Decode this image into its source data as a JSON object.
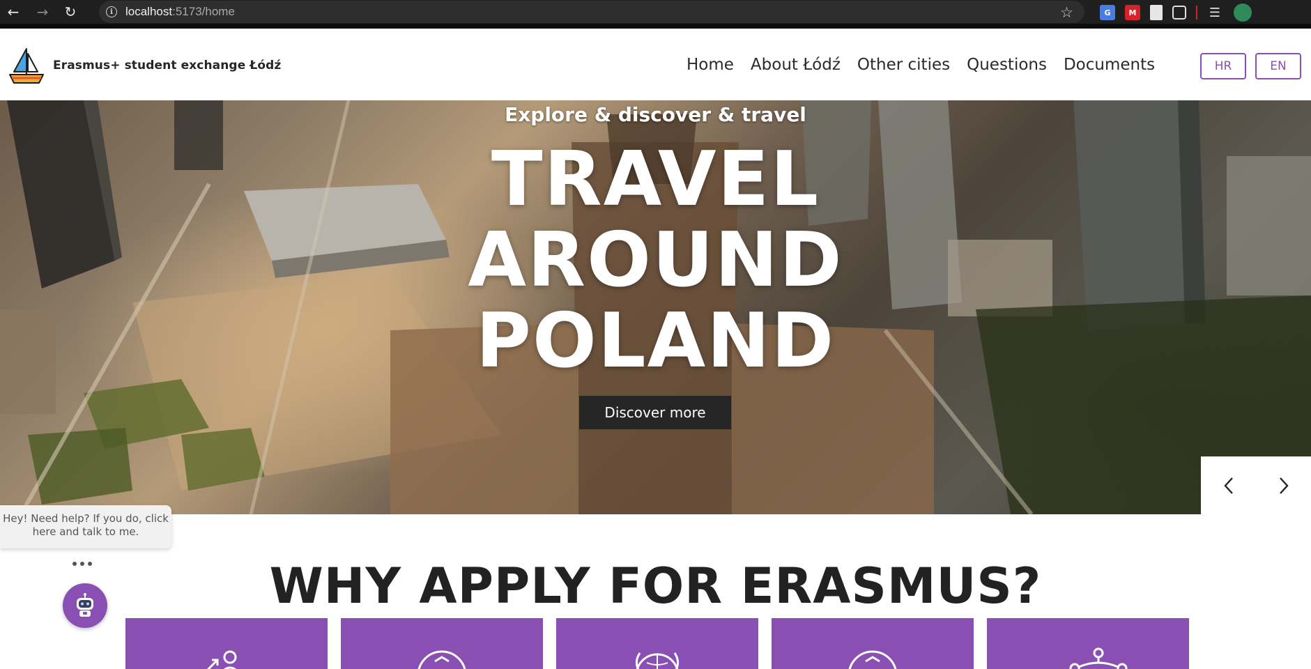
{
  "browser": {
    "url_host": "localhost",
    "url_path": ":5173/home"
  },
  "header": {
    "brand": "Erasmus+ student exchange Łódź",
    "nav": [
      "Home",
      "About Łódź",
      "Other cities",
      "Questions",
      "Documents"
    ],
    "languages": [
      "HR",
      "EN"
    ]
  },
  "hero": {
    "kicker": "Explore & discover & travel",
    "title_lines": [
      "TRAVEL",
      "AROUND",
      "POLAND"
    ],
    "button": "Discover more"
  },
  "chat": {
    "message": "Hey! Need help? If you do, click here and talk to me."
  },
  "section": {
    "title": "WHY APPLY FOR ERASMUS?"
  },
  "colors": {
    "accent": "#8a4fb3",
    "dark": "#262626"
  }
}
